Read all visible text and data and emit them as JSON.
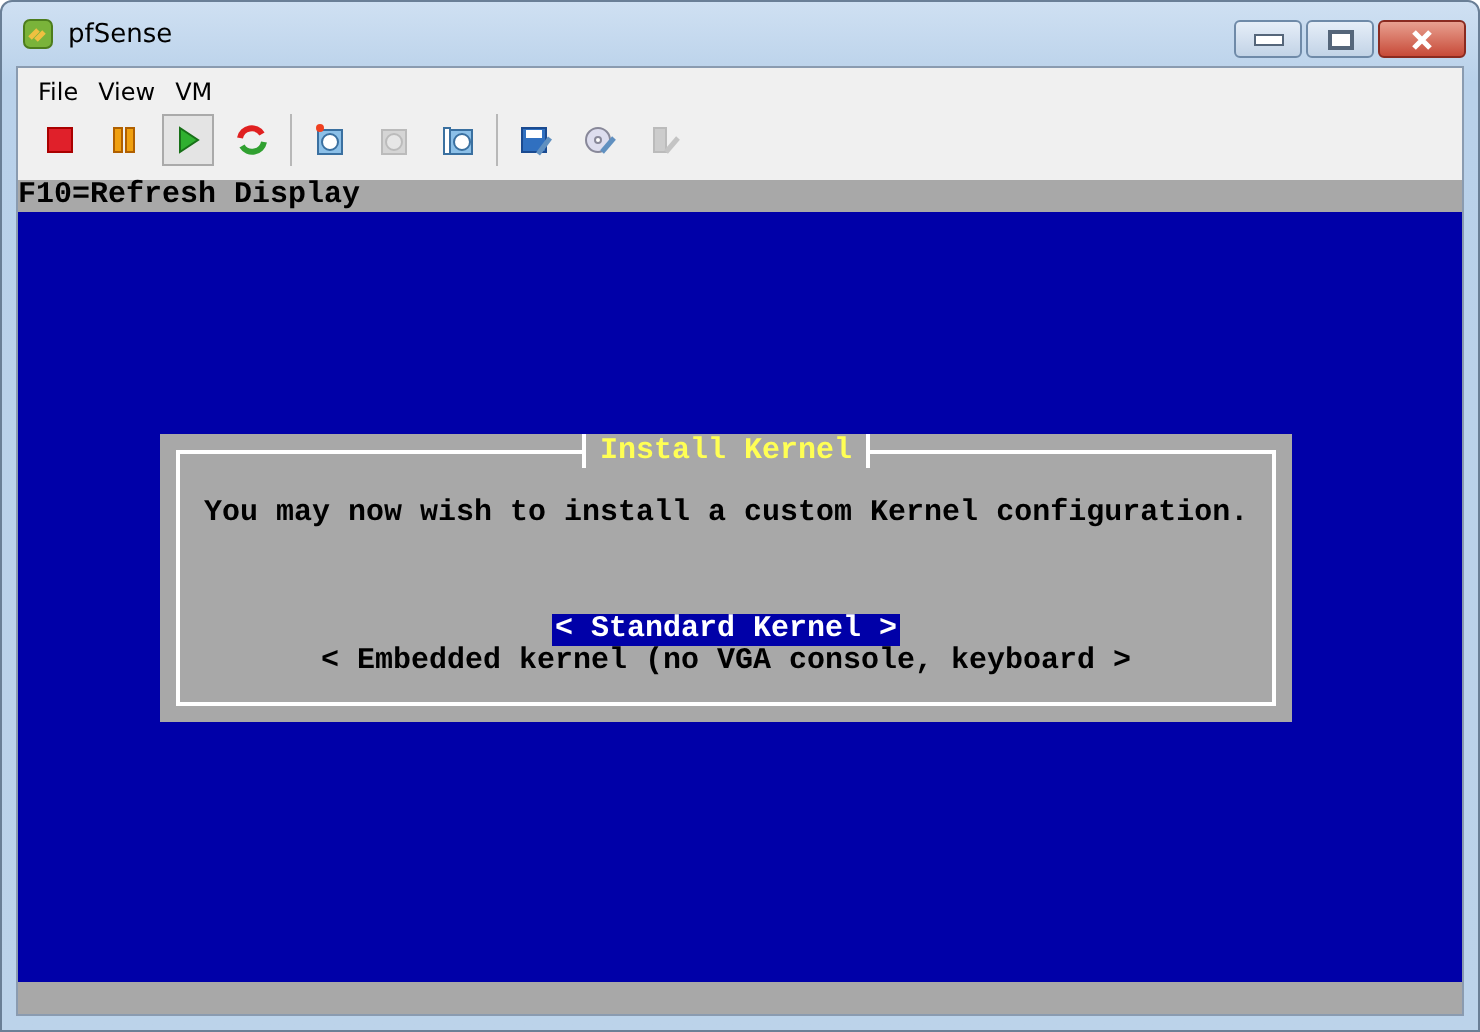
{
  "window": {
    "title": "pfSense"
  },
  "menu": [
    {
      "label": "File"
    },
    {
      "label": "View"
    },
    {
      "label": "VM"
    }
  ],
  "toolbar": [
    {
      "kind": "stop",
      "disabled": false,
      "selected": false
    },
    {
      "kind": "pause",
      "disabled": false,
      "selected": false
    },
    {
      "kind": "play",
      "disabled": false,
      "selected": true
    },
    {
      "kind": "reset",
      "disabled": false,
      "selected": false
    },
    {
      "kind": "separator"
    },
    {
      "kind": "snapshot",
      "disabled": false,
      "selected": false
    },
    {
      "kind": "revert",
      "disabled": true,
      "selected": false
    },
    {
      "kind": "manage",
      "disabled": false,
      "selected": false
    },
    {
      "kind": "separator"
    },
    {
      "kind": "floppy",
      "disabled": false,
      "selected": false
    },
    {
      "kind": "cd",
      "disabled": false,
      "selected": false
    },
    {
      "kind": "usb",
      "disabled": true,
      "selected": false
    }
  ],
  "console": {
    "top_line": "F10=Refresh Display",
    "dialog": {
      "title": "Install Kernel",
      "message": "You may now wish to install a custom Kernel configuration.",
      "options": [
        {
          "label": "< Standard Kernel >",
          "selected": true
        },
        {
          "label": "< Embedded kernel (no VGA console, keyboard >",
          "selected": false
        }
      ]
    }
  }
}
